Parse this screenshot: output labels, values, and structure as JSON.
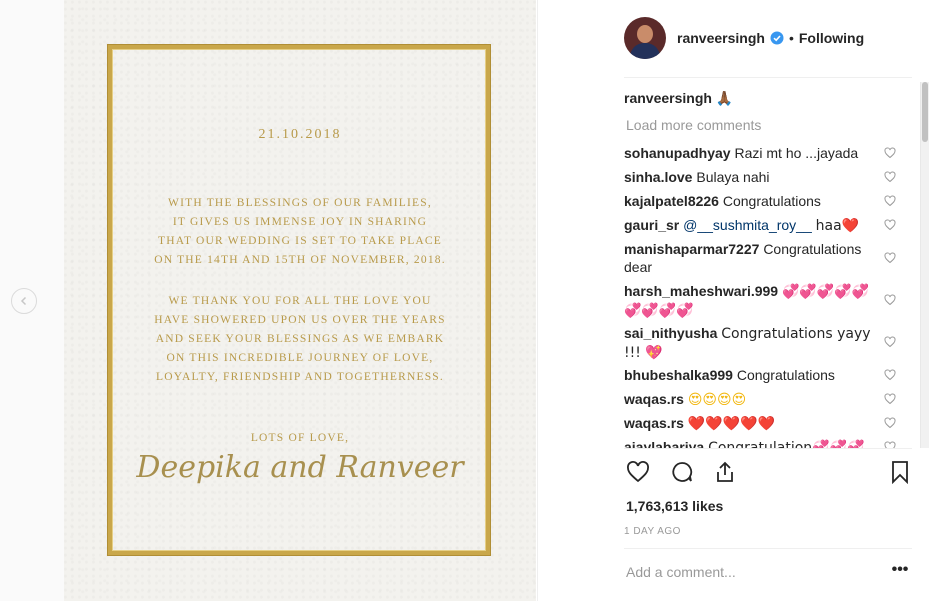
{
  "colors": {
    "gold": "#c9a74a",
    "link": "#003569",
    "muted": "#999999",
    "heart_red": "#e2231a"
  },
  "invitation": {
    "date": "21.10.2018",
    "paragraph1": [
      "With the blessings of our families,",
      "it gives us immense joy in sharing",
      "that our wedding is set to take place",
      "on the 14th and 15th of November, 2018."
    ],
    "paragraph2": [
      "We thank you for all the love you",
      "have showered upon us over the years",
      "and seek your blessings as we embark",
      "on this incredible journey of love,",
      "loyalty, friendship and togetherness."
    ],
    "closing": "Lots of love,",
    "signature": "Deepika and Ranveer"
  },
  "header": {
    "username": "ranveersingh",
    "verified_icon": "verified-badge-icon",
    "separator": "•",
    "follow_status": "Following"
  },
  "caption": {
    "username": "ranveersingh",
    "text": "🙏🏾"
  },
  "load_more": "Load more comments",
  "comments": [
    {
      "user": "sohanupadhyay",
      "text": "Razi mt ho ...jayada"
    },
    {
      "user": "sinha.love",
      "text": "Bulaya nahi"
    },
    {
      "user": "kajalpatel8226",
      "text": "Congratulations"
    },
    {
      "user": "gauri_sr",
      "mention": "@__sushmita_roy__",
      "text": "haa❤️"
    },
    {
      "user": "manishaparmar7227",
      "text": "Congratulations dear"
    },
    {
      "user": "harsh_maheshwari.999",
      "text": "💞💞💞💞💞💞💞💞💞"
    },
    {
      "user": "sai_nithyusha",
      "text": "Congratulations yayy !!! 💖"
    },
    {
      "user": "bhubeshalka999",
      "text": "Congratulations"
    },
    {
      "user": "waqas.rs",
      "text": "😍😍😍😍"
    },
    {
      "user": "waqas.rs",
      "text": "❤️❤️❤️❤️❤️"
    },
    {
      "user": "ajaylabariya",
      "text": "Congratulation💞💞💞"
    }
  ],
  "likes": "1,763,613 likes",
  "time_ago": "1 DAY AGO",
  "add_comment_placeholder": "Add a comment...",
  "more_options": "•••"
}
